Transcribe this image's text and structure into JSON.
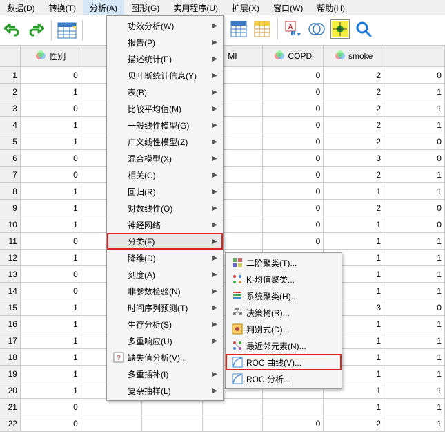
{
  "menubar": [
    {
      "label": "数据(D)"
    },
    {
      "label": "转换(T)"
    },
    {
      "label": "分析(A)",
      "active": true
    },
    {
      "label": "图形(G)"
    },
    {
      "label": "实用程序(U)"
    },
    {
      "label": "扩展(X)"
    },
    {
      "label": "窗口(W)"
    },
    {
      "label": "帮助(H)"
    }
  ],
  "toolbar": {
    "undo": "undo-icon",
    "redo": "redo-icon"
  },
  "columns": [
    {
      "label": "性别",
      "icon": "venn"
    },
    {
      "label": "",
      "icon": null
    },
    {
      "label": "",
      "icon": null
    },
    {
      "label": "MI",
      "icon": null
    },
    {
      "label": "COPD",
      "icon": "venn"
    },
    {
      "label": "smoke",
      "icon": "venn"
    },
    {
      "label": "",
      "icon": null
    }
  ],
  "rows": [
    {
      "n": 1,
      "cells": [
        "0",
        "",
        "",
        "",
        "0",
        "2",
        "0"
      ]
    },
    {
      "n": 2,
      "cells": [
        "1",
        "",
        "",
        "",
        "0",
        "2",
        "1"
      ]
    },
    {
      "n": 3,
      "cells": [
        "0",
        "",
        "",
        "",
        "0",
        "2",
        "1"
      ]
    },
    {
      "n": 4,
      "cells": [
        "1",
        "",
        "",
        "",
        "0",
        "2",
        "1"
      ]
    },
    {
      "n": 5,
      "cells": [
        "1",
        "",
        "",
        "",
        "0",
        "2",
        "0"
      ]
    },
    {
      "n": 6,
      "cells": [
        "0",
        "",
        "",
        "",
        "0",
        "3",
        "0"
      ]
    },
    {
      "n": 7,
      "cells": [
        "0",
        "",
        "",
        "",
        "0",
        "2",
        "1"
      ]
    },
    {
      "n": 8,
      "cells": [
        "1",
        "",
        "",
        "",
        "0",
        "1",
        "1"
      ]
    },
    {
      "n": 9,
      "cells": [
        "1",
        "",
        "",
        "",
        "0",
        "2",
        "0"
      ]
    },
    {
      "n": 10,
      "cells": [
        "1",
        "",
        "",
        "",
        "0",
        "1",
        "0"
      ]
    },
    {
      "n": 11,
      "cells": [
        "0",
        "",
        "",
        "",
        "0",
        "1",
        "1"
      ]
    },
    {
      "n": 12,
      "cells": [
        "1",
        "",
        "",
        "",
        "",
        "1",
        "1"
      ]
    },
    {
      "n": 13,
      "cells": [
        "0",
        "",
        "",
        "",
        "",
        "1",
        "1"
      ]
    },
    {
      "n": 14,
      "cells": [
        "0",
        "",
        "",
        "",
        "",
        "1",
        "1"
      ]
    },
    {
      "n": 15,
      "cells": [
        "1",
        "",
        "",
        "",
        "",
        "3",
        "0"
      ]
    },
    {
      "n": 16,
      "cells": [
        "1",
        "",
        "",
        "",
        "",
        "1",
        "1"
      ]
    },
    {
      "n": 17,
      "cells": [
        "1",
        "",
        "",
        "",
        "",
        "1",
        "1"
      ]
    },
    {
      "n": 18,
      "cells": [
        "1",
        "",
        "",
        "",
        "",
        "1",
        "1"
      ]
    },
    {
      "n": 19,
      "cells": [
        "1",
        "",
        "",
        "",
        "",
        "1",
        "1"
      ]
    },
    {
      "n": 20,
      "cells": [
        "1",
        "",
        "",
        "",
        "",
        "1",
        "1"
      ]
    },
    {
      "n": 21,
      "cells": [
        "0",
        "",
        "",
        "",
        "",
        "1",
        "1"
      ]
    },
    {
      "n": 22,
      "cells": [
        "0",
        "",
        "",
        "",
        "0",
        "2",
        "1"
      ]
    }
  ],
  "dropdown": {
    "items": [
      {
        "label": "功效分析(W)",
        "arrow": true
      },
      {
        "label": "报告(P)",
        "arrow": true
      },
      {
        "label": "描述统计(E)",
        "arrow": true
      },
      {
        "label": "贝叶斯统计信息(Y)",
        "arrow": true
      },
      {
        "label": "表(B)",
        "arrow": true
      },
      {
        "label": "比较平均值(M)",
        "arrow": true
      },
      {
        "label": "一般线性模型(G)",
        "arrow": true
      },
      {
        "label": "广义线性模型(Z)",
        "arrow": true
      },
      {
        "label": "混合模型(X)",
        "arrow": true
      },
      {
        "label": "相关(C)",
        "arrow": true
      },
      {
        "label": "回归(R)",
        "arrow": true
      },
      {
        "label": "对数线性(O)",
        "arrow": true
      },
      {
        "label": "神经网络",
        "arrow": true
      },
      {
        "label": "分类(F)",
        "arrow": true,
        "boxed": true,
        "hov": true
      },
      {
        "label": "降维(D)",
        "arrow": true
      },
      {
        "label": "刻度(A)",
        "arrow": true
      },
      {
        "label": "非参数检验(N)",
        "arrow": true
      },
      {
        "label": "时间序列预测(T)",
        "arrow": true
      },
      {
        "label": "生存分析(S)",
        "arrow": true
      },
      {
        "label": "多重响应(U)",
        "arrow": true
      },
      {
        "label": "缺失值分析(V)...",
        "arrow": false,
        "icon": "missing"
      },
      {
        "label": "多重插补(I)",
        "arrow": true
      },
      {
        "label": "复杂抽样(L)",
        "arrow": true
      }
    ]
  },
  "submenu": {
    "items": [
      {
        "label": "二阶聚类(T)...",
        "icon": "cluster2"
      },
      {
        "label": "K-均值聚类...",
        "icon": "kmeans"
      },
      {
        "label": "系统聚类(H)...",
        "icon": "hier"
      },
      {
        "label": "决策树(R)...",
        "icon": "tree"
      },
      {
        "label": "判别式(D)...",
        "icon": "disc"
      },
      {
        "label": "最近邻元素(N)...",
        "icon": "nn"
      },
      {
        "label": "ROC 曲线(V)...",
        "icon": "roc",
        "boxed": true
      },
      {
        "label": "ROC 分析...",
        "icon": "roc"
      }
    ]
  }
}
